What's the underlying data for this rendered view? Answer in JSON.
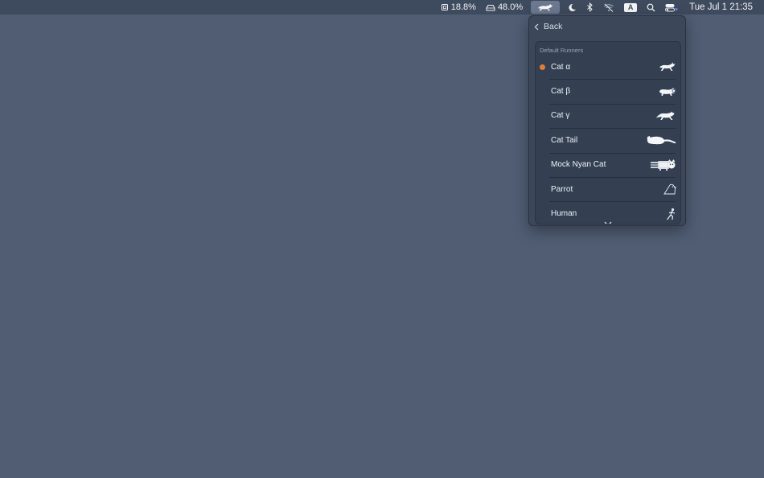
{
  "menubar": {
    "cpu_value": "18.8%",
    "disk_value": "48.0%",
    "items": [
      {
        "icon": "cpu-icon"
      },
      {
        "icon": "disk-icon"
      },
      {
        "icon": "runcat-icon"
      },
      {
        "icon": "moon-icon"
      },
      {
        "icon": "bluetooth-icon"
      },
      {
        "icon": "wifi-off-icon"
      },
      {
        "icon": "input-source-icon"
      },
      {
        "icon": "search-icon"
      },
      {
        "icon": "control-center-icon"
      }
    ],
    "input_source_label": "A",
    "clock": "Tue Jul 1  21:35"
  },
  "panel": {
    "back_label": "Back",
    "group_title": "Default Runners",
    "runners": [
      {
        "label": "Cat α",
        "icon": "cat-alpha-icon",
        "selected": true
      },
      {
        "label": "Cat β",
        "icon": "cat-beta-icon",
        "selected": false
      },
      {
        "label": "Cat γ",
        "icon": "cat-gamma-icon",
        "selected": false
      },
      {
        "label": "Cat Tail",
        "icon": "cat-tail-icon",
        "selected": false
      },
      {
        "label": "Mock Nyan Cat",
        "icon": "nyan-cat-icon",
        "selected": false
      },
      {
        "label": "Parrot",
        "icon": "parrot-icon",
        "selected": false
      },
      {
        "label": "Human",
        "icon": "human-icon",
        "selected": false
      }
    ],
    "selected_color": "#e07d36"
  },
  "colors": {
    "desktop": "#505d73",
    "menubar": "#3e4a5d",
    "panel": "#3c4759"
  }
}
